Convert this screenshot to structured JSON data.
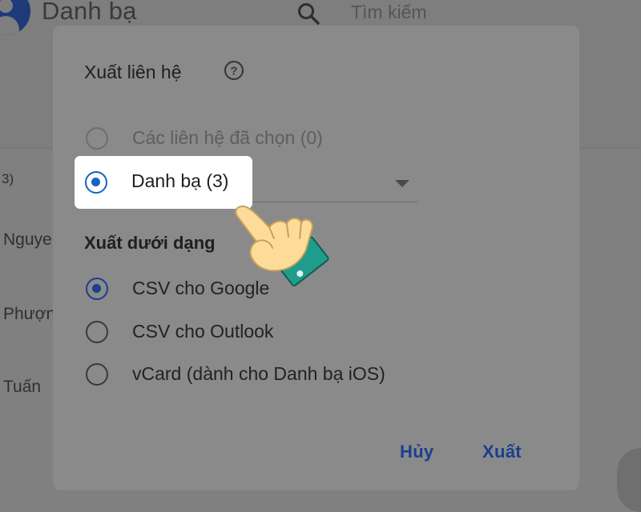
{
  "app": {
    "title": "Danh bạ",
    "search_placeholder": "Tìm kiếm",
    "contact_count_fragment": "3)",
    "contact_names": [
      "Nguye",
      "Phượn",
      "Tuấn"
    ]
  },
  "dialog": {
    "title": "Xuất liên hệ",
    "source_options": [
      {
        "label": "Các liên hệ đã chọn (0)",
        "disabled": true,
        "checked": false
      },
      {
        "label": "Danh bạ (3)",
        "disabled": false,
        "checked": true
      }
    ],
    "format_section_title": "Xuất dưới dạng",
    "format_options": [
      {
        "label": "CSV cho Google",
        "checked": true
      },
      {
        "label": "CSV cho Outlook",
        "checked": false
      },
      {
        "label": "vCard (dành cho Danh bạ iOS)",
        "checked": false
      }
    ],
    "cancel_label": "Hủy",
    "export_label": "Xuất"
  },
  "icons": {
    "search": "search-icon",
    "help": "help-circle-icon",
    "avatar": "contacts-avatar-icon",
    "dropdown": "dropdown-arrow-icon",
    "hand": "pointing-hand-icon"
  },
  "colors": {
    "accent": "#1a3f8f",
    "highlight_radio": "#1565c0",
    "overlay_background": "#808080",
    "dialog_background": "#8a8a8a",
    "hand_cuff": "#1f9c8a",
    "hand_skin": "#fddc9a"
  }
}
